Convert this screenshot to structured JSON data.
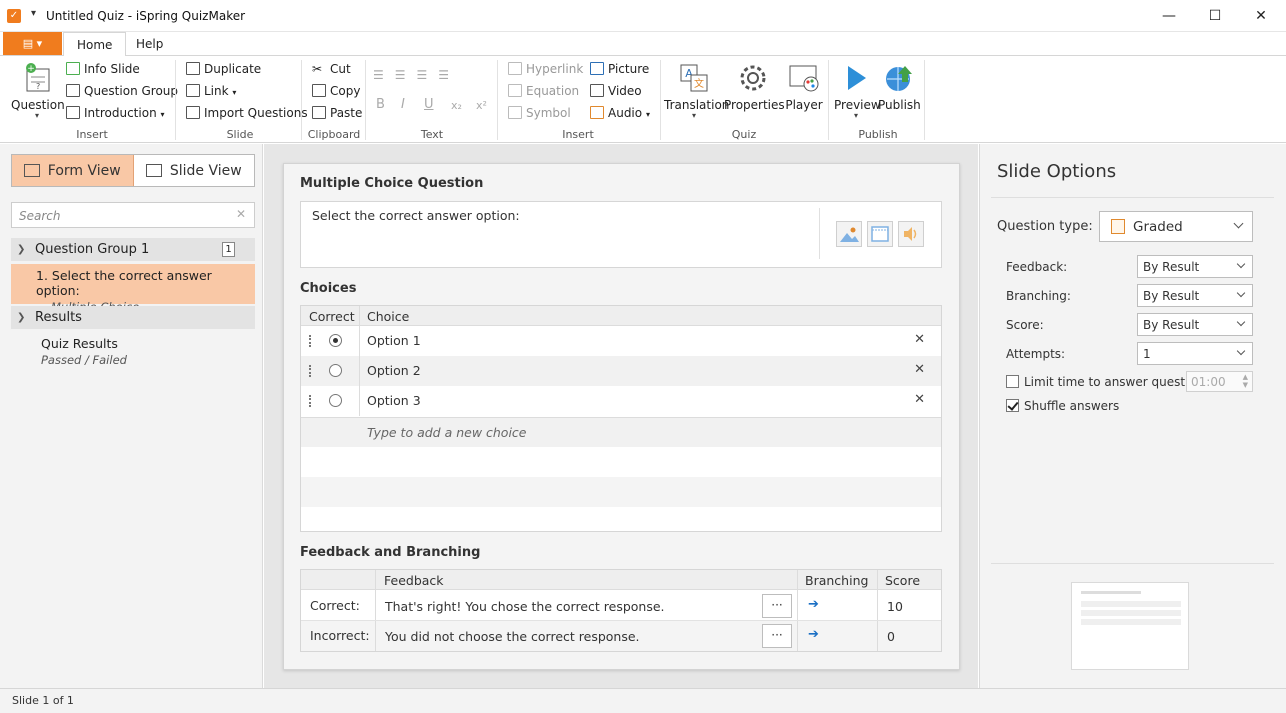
{
  "window": {
    "title": "Untitled Quiz - iSpring QuizMaker",
    "minimize_glyph": "—",
    "maximize_glyph": "☐",
    "close_glyph": "✕"
  },
  "ribbon": {
    "tabs": [
      {
        "label": "Home"
      },
      {
        "label": "Help"
      }
    ],
    "insert_group": {
      "label": "Insert",
      "question": "Question",
      "info_slide": "Info Slide",
      "question_group": "Question Group",
      "introduction": "Introduction"
    },
    "slide_group": {
      "label": "Slide",
      "duplicate": "Duplicate",
      "link": "Link",
      "import_questions": "Import Questions"
    },
    "clipboard_group": {
      "label": "Clipboard",
      "cut": "Cut",
      "copy": "Copy",
      "paste": "Paste"
    },
    "text_group": {
      "label": "Text"
    },
    "insert2_group": {
      "label": "Insert",
      "hyperlink": "Hyperlink",
      "equation": "Equation",
      "symbol": "Symbol",
      "picture": "Picture",
      "video": "Video",
      "audio": "Audio"
    },
    "quiz_group": {
      "label": "Quiz",
      "translation": "Translation",
      "properties": "Properties",
      "player": "Player"
    },
    "publish_group": {
      "label": "Publish",
      "preview": "Preview",
      "publish": "Publish"
    }
  },
  "left_pane": {
    "form_view": "Form View",
    "slide_view": "Slide View",
    "search_placeholder": "Search",
    "question_group": {
      "label": "Question Group 1",
      "count": "1"
    },
    "question": {
      "title": "1.  Select the correct answer option:",
      "subtitle": "Multiple Choice"
    },
    "results": {
      "label": "Results",
      "item_title": "Quiz Results",
      "item_subtitle": "Passed / Failed"
    }
  },
  "editor": {
    "heading": "Multiple Choice Question",
    "question_text": "Select the correct answer option:",
    "choices_heading": "Choices",
    "choices_columns": {
      "correct": "Correct",
      "choice": "Choice"
    },
    "choices": [
      {
        "label": "Option 1",
        "correct": true
      },
      {
        "label": "Option 2",
        "correct": false
      },
      {
        "label": "Option 3",
        "correct": false
      }
    ],
    "add_choice_placeholder": "Type to add a new choice",
    "feedback_heading": "Feedback and Branching",
    "feedback_columns": {
      "feedback": "Feedback",
      "branching": "Branching",
      "score": "Score"
    },
    "feedback_rows": [
      {
        "label": "Correct:",
        "text": "That's right! You chose the correct response.",
        "score": "10"
      },
      {
        "label": "Incorrect:",
        "text": "You did not choose the correct response.",
        "score": "0"
      }
    ],
    "more_glyph": "···",
    "branch_glyph": "➔"
  },
  "slide_options": {
    "title": "Slide Options",
    "question_type_label": "Question type:",
    "question_type_value": "Graded",
    "feedback_label": "Feedback:",
    "feedback_value": "By Result",
    "branching_label": "Branching:",
    "branching_value": "By Result",
    "score_label": "Score:",
    "score_value": "By Result",
    "attempts_label": "Attempts:",
    "attempts_value": "1",
    "limit_time_label": "Limit time to answer question:",
    "limit_time_value": "01:00",
    "limit_time_checked": false,
    "shuffle_label": "Shuffle answers",
    "shuffle_checked": true
  },
  "status": {
    "text": "Slide 1 of 1"
  },
  "colors": {
    "accent": "#f07c1e",
    "selection": "#f9c8a6",
    "link_blue": "#1a6fc4"
  }
}
